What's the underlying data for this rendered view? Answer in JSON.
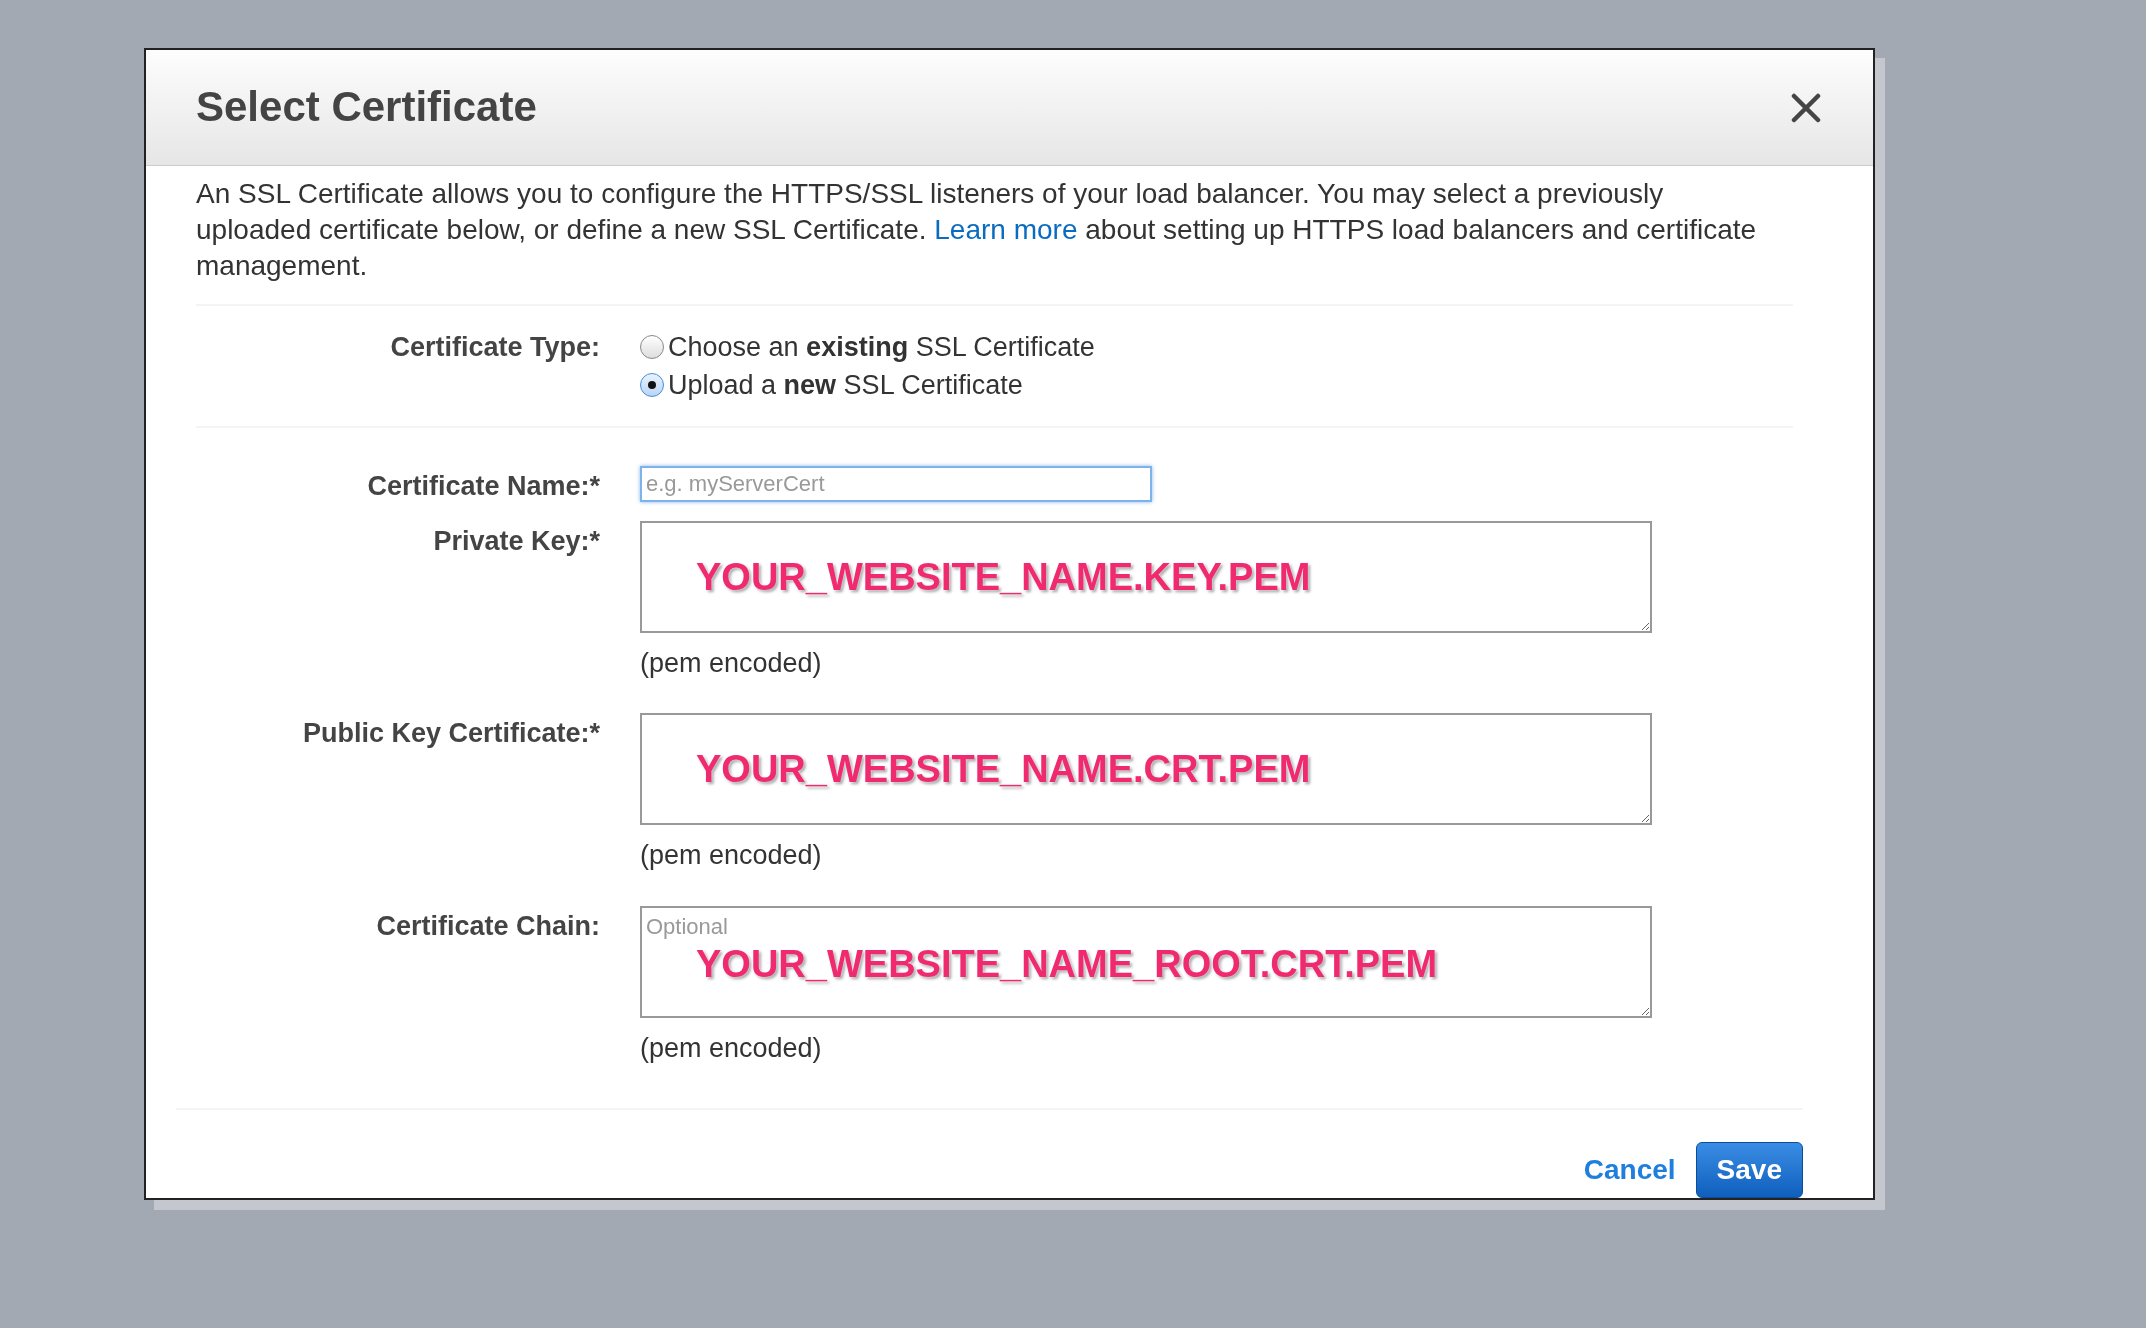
{
  "dialog": {
    "title": "Select Certificate"
  },
  "intro": {
    "before": "An SSL Certificate allows you to configure the HTTPS/SSL listeners of your load balancer. You may select a previously uploaded certificate below, or define a new SSL Certificate.",
    "link": "Learn more",
    "after": "about setting up HTTPS load balancers and certificate management."
  },
  "certificate_type": {
    "label": "Certificate Type:",
    "options": [
      {
        "text": "Choose an **existing** SSL Certificate",
        "selected": false
      },
      {
        "text": "Upload a **new** SSL Certificate",
        "selected": true
      }
    ]
  },
  "fields": [
    {
      "kind": "input",
      "label": "Certificate Name:*",
      "placeholder": "e.g. myServerCert",
      "focused": true
    },
    {
      "kind": "textarea",
      "label": "Private Key:*",
      "annotation": "YOUR_WEBSITE_NAME.KEY.PEM",
      "hint": "(pem encoded)"
    },
    {
      "kind": "textarea",
      "label": "Public Key Certificate:*",
      "annotation": "YOUR_WEBSITE_NAME.CRT.PEM",
      "hint": "(pem encoded)"
    },
    {
      "kind": "textarea",
      "label": "Certificate Chain:",
      "placeholder": "Optional",
      "annotation": "YOUR_WEBSITE_NAME_ROOT.CRT.PEM",
      "hint": "(pem encoded)"
    }
  ],
  "buttons": {
    "cancel": "Cancel",
    "save": "Save"
  }
}
